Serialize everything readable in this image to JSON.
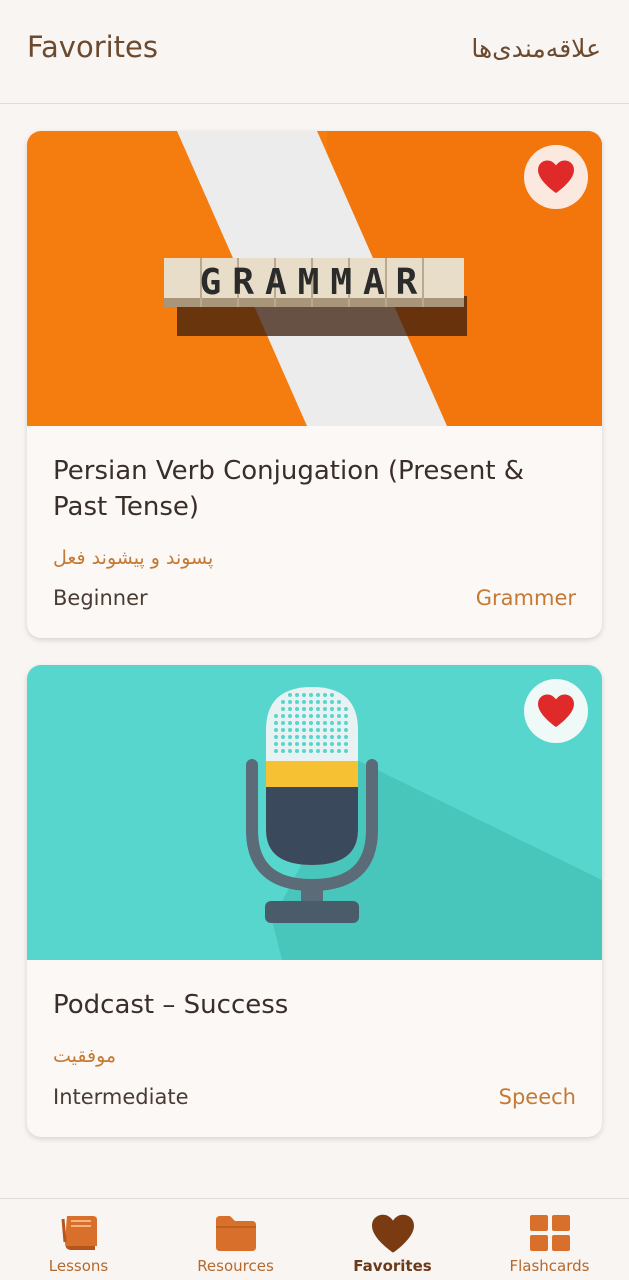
{
  "header": {
    "title_en": "Favorites",
    "title_fa": "علاقه‌مندی‌ها"
  },
  "cards": [
    {
      "image_text": "GRAMMAR",
      "title": "Persian Verb Conjugation (Present & Past Tense)",
      "subtitle_fa": "پسوند و پیشوند فعل",
      "level": "Beginner",
      "category": "Grammer",
      "favorited": true,
      "image_bg": "#f57c0f"
    },
    {
      "title": "Podcast – Success",
      "subtitle_fa": "موفقیت",
      "level": "Intermediate",
      "category": "Speech",
      "favorited": true,
      "image_bg": "#56d6cc"
    }
  ],
  "bottom_nav": [
    {
      "label": "Lessons",
      "icon": "book-icon",
      "active": false
    },
    {
      "label": "Resources",
      "icon": "folder-icon",
      "active": false
    },
    {
      "label": "Favorites",
      "icon": "heart-icon",
      "active": true
    },
    {
      "label": "Flashcards",
      "icon": "grid-icon",
      "active": false
    }
  ],
  "colors": {
    "accent": "#c47a34",
    "active_nav": "#6b3a1a",
    "heart": "#e02a2a",
    "background": "#f9f5f2"
  }
}
